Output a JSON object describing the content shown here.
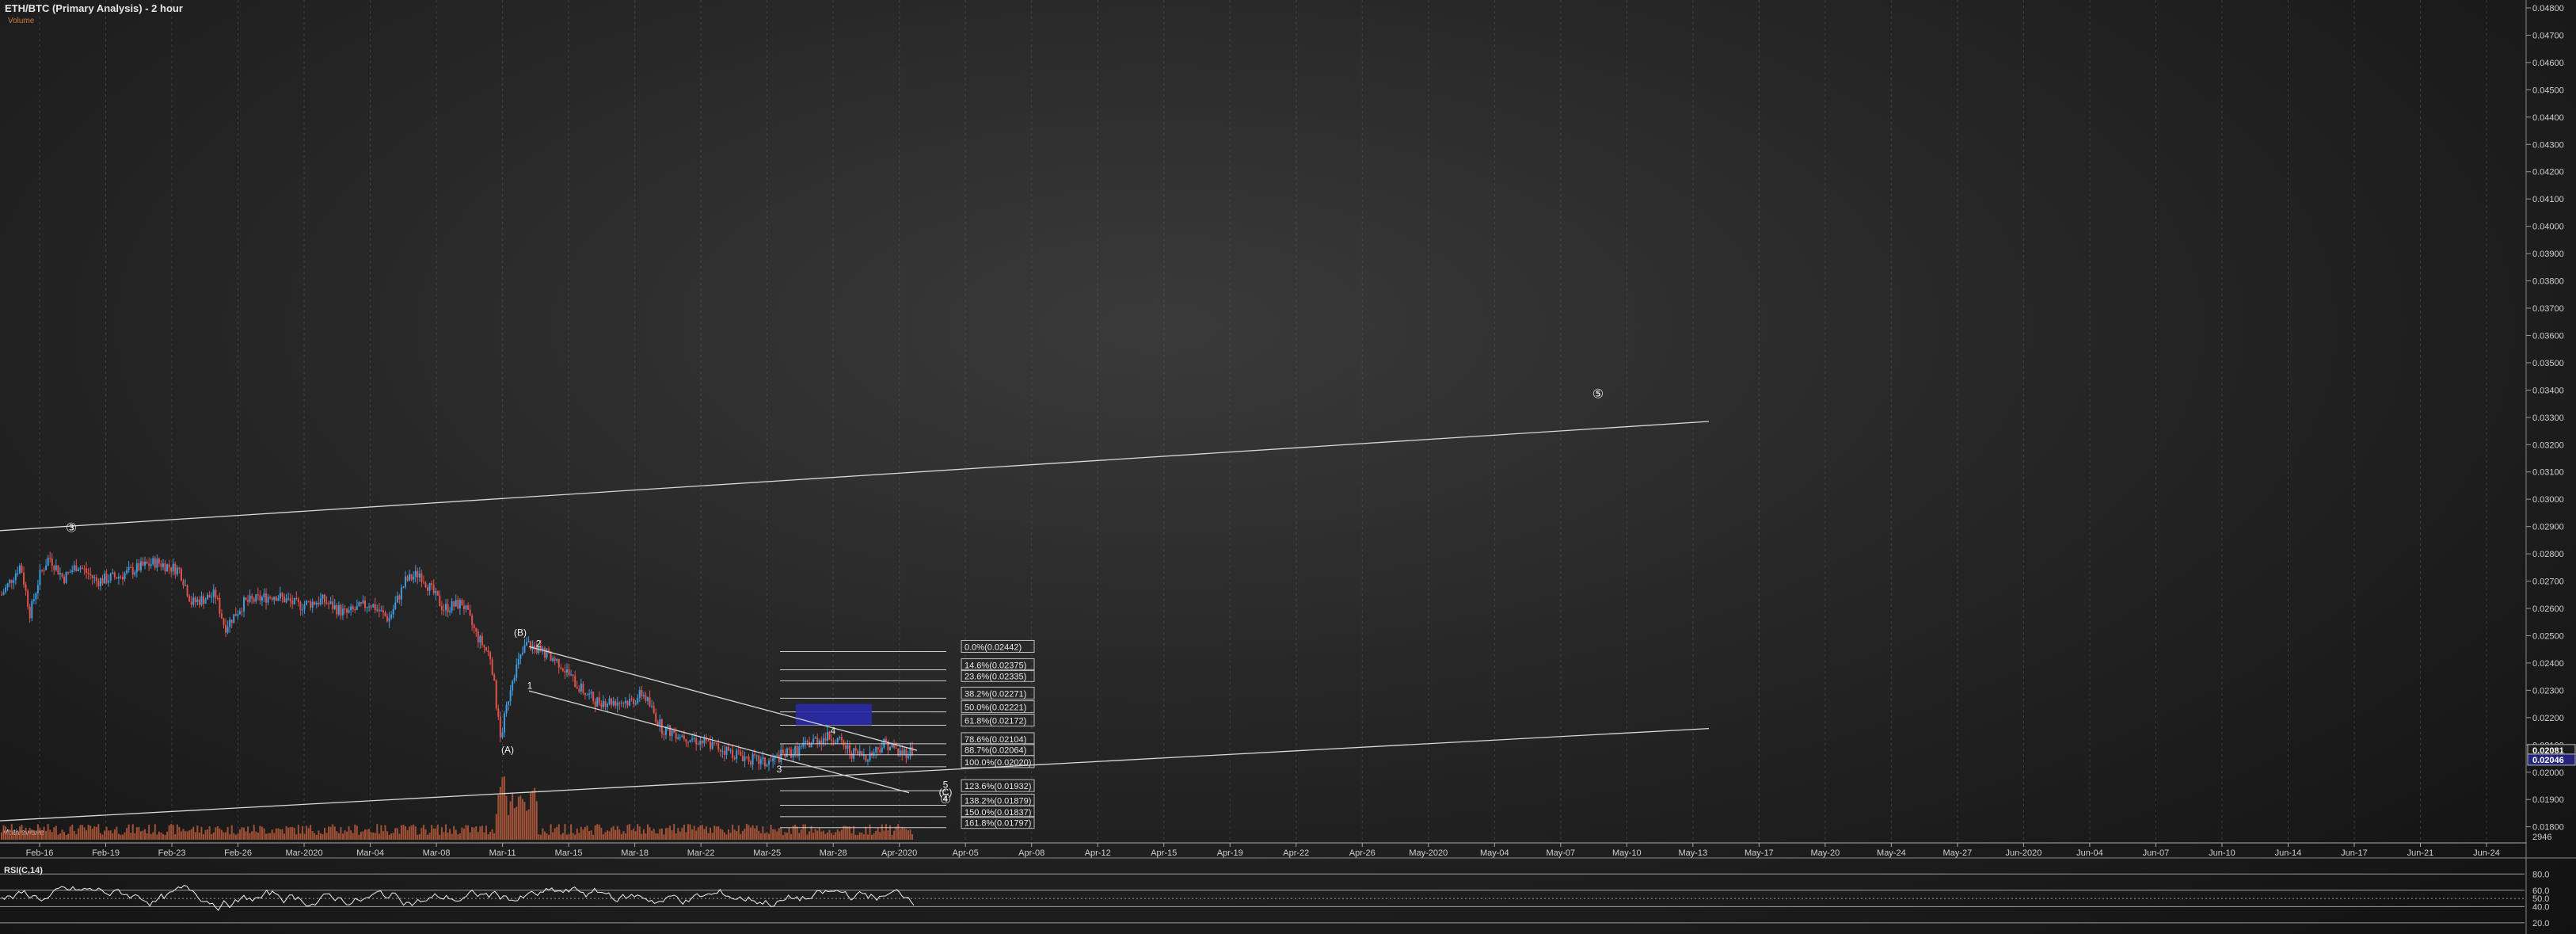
{
  "header": {
    "title": "ETH/BTC (Primary Analysis) - 2 hour",
    "subtitle": "Volume"
  },
  "indicators": {
    "volume_label": "Motivewave",
    "rsi_label": "RSI(C,14)",
    "rsi_levels": [
      "80.0",
      "60.0",
      "50.0",
      "40.0",
      "20.0"
    ],
    "volume_value": "2946"
  },
  "colors": {
    "up": "#3d9be0",
    "down": "#e0524a",
    "volume": "#b0583a",
    "fib_box": "#2a2aa8",
    "line": "#d9d9d9"
  },
  "chart_data": {
    "type": "candlestick",
    "title": "ETH/BTC (Primary Analysis) - 2 hour",
    "ylim": [
      0.0177,
      0.048
    ],
    "y_ticks": [
      "0.04800",
      "0.04700",
      "0.04600",
      "0.04500",
      "0.04400",
      "0.04300",
      "0.04200",
      "0.04100",
      "0.04000",
      "0.03900",
      "0.03800",
      "0.03700",
      "0.03600",
      "0.03500",
      "0.03400",
      "0.03300",
      "0.03200",
      "0.03100",
      "0.03000",
      "0.02900",
      "0.02800",
      "0.02700",
      "0.02600",
      "0.02500",
      "0.02400",
      "0.02300",
      "0.02200",
      "0.02100",
      "0.02000",
      "0.01900",
      "0.01800"
    ],
    "x_ticks": [
      "Feb-16",
      "Feb-19",
      "Feb-23",
      "Feb-26",
      "Mar-2020",
      "Mar-04",
      "Mar-08",
      "Mar-11",
      "Mar-15",
      "Mar-18",
      "Mar-22",
      "Mar-25",
      "Mar-28",
      "Apr-2020",
      "Apr-05",
      "Apr-08",
      "Apr-12",
      "Apr-15",
      "Apr-19",
      "Apr-22",
      "Apr-26",
      "May-2020",
      "May-04",
      "May-07",
      "May-10",
      "May-13",
      "May-17",
      "May-20",
      "May-24",
      "May-27",
      "Jun-2020",
      "Jun-04",
      "Jun-07",
      "Jun-10",
      "Jun-14",
      "Jun-17",
      "Jun-21",
      "Jun-24"
    ],
    "price_path": [
      [
        0,
        0.0265
      ],
      [
        0.8,
        0.0276
      ],
      [
        1.2,
        0.0258
      ],
      [
        1.6,
        0.0272
      ],
      [
        2.0,
        0.0279
      ],
      [
        2.6,
        0.0271
      ],
      [
        3.2,
        0.0276
      ],
      [
        4.0,
        0.027
      ],
      [
        5.0,
        0.0272
      ],
      [
        5.8,
        0.0275
      ],
      [
        6.5,
        0.0277
      ],
      [
        7.5,
        0.0274
      ],
      [
        8.0,
        0.0262
      ],
      [
        9.0,
        0.0265
      ],
      [
        9.4,
        0.0253
      ],
      [
        10.2,
        0.0262
      ],
      [
        11.5,
        0.0265
      ],
      [
        12.5,
        0.0261
      ],
      [
        13.5,
        0.0263
      ],
      [
        14.5,
        0.0258
      ],
      [
        15.5,
        0.0262
      ],
      [
        16.3,
        0.0256
      ],
      [
        17.0,
        0.027
      ],
      [
        17.6,
        0.0273
      ],
      [
        18.6,
        0.026
      ],
      [
        19.4,
        0.0262
      ],
      [
        20.0,
        0.025
      ],
      [
        20.6,
        0.0242
      ],
      [
        21.0,
        0.0212
      ],
      [
        21.5,
        0.0235
      ],
      [
        22.1,
        0.0247
      ],
      [
        22.8,
        0.0244
      ],
      [
        23.5,
        0.024
      ],
      [
        24.2,
        0.0232
      ],
      [
        25.0,
        0.0226
      ],
      [
        26.5,
        0.0226
      ],
      [
        27.0,
        0.0229
      ],
      [
        27.8,
        0.0216
      ],
      [
        28.5,
        0.0214
      ],
      [
        29.5,
        0.0211
      ],
      [
        30.5,
        0.0208
      ],
      [
        31.5,
        0.0205
      ],
      [
        32.2,
        0.0203
      ],
      [
        32.8,
        0.0206
      ],
      [
        33.5,
        0.0208
      ],
      [
        34.3,
        0.0212
      ],
      [
        35.0,
        0.0213
      ],
      [
        35.8,
        0.0207
      ],
      [
        36.5,
        0.0206
      ],
      [
        37.2,
        0.0211
      ],
      [
        37.8,
        0.0207
      ],
      [
        38.4,
        0.0208
      ]
    ],
    "fib_levels": [
      {
        "label": "0.0%(0.02442)",
        "value": 0.02442
      },
      {
        "label": "14.6%(0.02375)",
        "value": 0.02375
      },
      {
        "label": "23.6%(0.02335)",
        "value": 0.02335
      },
      {
        "label": "38.2%(0.02271)",
        "value": 0.02271
      },
      {
        "label": "50.0%(0.02221)",
        "value": 0.02221
      },
      {
        "label": "61.8%(0.02172)",
        "value": 0.02172
      },
      {
        "label": "78.6%(0.02104)",
        "value": 0.02104
      },
      {
        "label": "88.7%(0.02064)",
        "value": 0.02064
      },
      {
        "label": "100.0%(0.02020)",
        "value": 0.0202
      },
      {
        "label": "123.6%(0.01932)",
        "value": 0.01932
      },
      {
        "label": "138.2%(0.01879)",
        "value": 0.01879
      },
      {
        "label": "150.0%(0.01837)",
        "value": 0.01837
      },
      {
        "label": "161.8%(0.01797)",
        "value": 0.01797
      }
    ],
    "wave_labels": [
      "(B)",
      "2",
      "1",
      "(A)",
      "3",
      "4",
      "5",
      "(C)",
      "③",
      "④",
      "⑤"
    ],
    "price_tags": [
      "0.02081",
      "0.02046"
    ]
  }
}
